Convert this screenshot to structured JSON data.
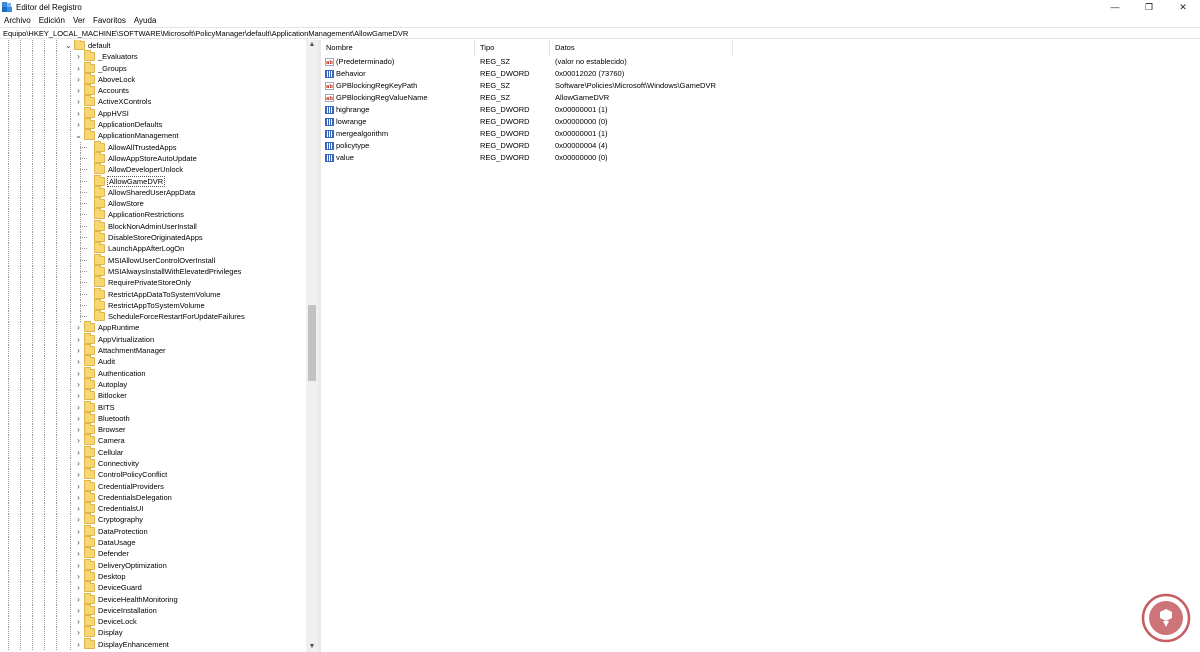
{
  "window": {
    "title": "Editor del Registro",
    "controls": {
      "minimize": "—",
      "maximize": "❐",
      "close": "✕"
    }
  },
  "menu": [
    "Archivo",
    "Edición",
    "Ver",
    "Favoritos",
    "Ayuda"
  ],
  "address": "Equipo\\HKEY_LOCAL_MACHINE\\SOFTWARE\\Microsoft\\PolicyManager\\default\\ApplicationManagement\\AllowGameDVR",
  "tree": [
    {
      "label": "default",
      "level": 0,
      "expander": "expanded"
    },
    {
      "label": "_Evaluators",
      "level": 1,
      "expander": "collapsed"
    },
    {
      "label": "_Groups",
      "level": 1,
      "expander": "collapsed"
    },
    {
      "label": "AboveLock",
      "level": 1,
      "expander": "collapsed"
    },
    {
      "label": "Accounts",
      "level": 1,
      "expander": "collapsed"
    },
    {
      "label": "ActiveXControls",
      "level": 1,
      "expander": "collapsed"
    },
    {
      "label": "AppHVSI",
      "level": 1,
      "expander": "collapsed"
    },
    {
      "label": "ApplicationDefaults",
      "level": 1,
      "expander": "collapsed"
    },
    {
      "label": "ApplicationManagement",
      "level": 1,
      "expander": "expanded"
    },
    {
      "label": "AllowAllTrustedApps",
      "level": 2,
      "expander": "none"
    },
    {
      "label": "AllowAppStoreAutoUpdate",
      "level": 2,
      "expander": "none"
    },
    {
      "label": "AllowDeveloperUnlock",
      "level": 2,
      "expander": "none"
    },
    {
      "label": "AllowGameDVR",
      "level": 2,
      "expander": "none",
      "selected": true
    },
    {
      "label": "AllowSharedUserAppData",
      "level": 2,
      "expander": "none"
    },
    {
      "label": "AllowStore",
      "level": 2,
      "expander": "none"
    },
    {
      "label": "ApplicationRestrictions",
      "level": 2,
      "expander": "none"
    },
    {
      "label": "BlockNonAdminUserInstall",
      "level": 2,
      "expander": "none"
    },
    {
      "label": "DisableStoreOriginatedApps",
      "level": 2,
      "expander": "none"
    },
    {
      "label": "LaunchAppAfterLogOn",
      "level": 2,
      "expander": "none"
    },
    {
      "label": "MSIAllowUserControlOverInstall",
      "level": 2,
      "expander": "none"
    },
    {
      "label": "MSIAlwaysInstallWithElevatedPrivileges",
      "level": 2,
      "expander": "none"
    },
    {
      "label": "RequirePrivateStoreOnly",
      "level": 2,
      "expander": "none"
    },
    {
      "label": "RestrictAppDataToSystemVolume",
      "level": 2,
      "expander": "none"
    },
    {
      "label": "RestrictAppToSystemVolume",
      "level": 2,
      "expander": "none"
    },
    {
      "label": "ScheduleForceRestartForUpdateFailures",
      "level": 2,
      "expander": "none"
    },
    {
      "label": "AppRuntime",
      "level": 1,
      "expander": "collapsed"
    },
    {
      "label": "AppVirtualization",
      "level": 1,
      "expander": "collapsed"
    },
    {
      "label": "AttachmentManager",
      "level": 1,
      "expander": "collapsed"
    },
    {
      "label": "Audit",
      "level": 1,
      "expander": "collapsed"
    },
    {
      "label": "Authentication",
      "level": 1,
      "expander": "collapsed"
    },
    {
      "label": "Autoplay",
      "level": 1,
      "expander": "collapsed"
    },
    {
      "label": "Bitlocker",
      "level": 1,
      "expander": "collapsed"
    },
    {
      "label": "BITS",
      "level": 1,
      "expander": "collapsed"
    },
    {
      "label": "Bluetooth",
      "level": 1,
      "expander": "collapsed"
    },
    {
      "label": "Browser",
      "level": 1,
      "expander": "collapsed"
    },
    {
      "label": "Camera",
      "level": 1,
      "expander": "collapsed"
    },
    {
      "label": "Cellular",
      "level": 1,
      "expander": "collapsed"
    },
    {
      "label": "Connectivity",
      "level": 1,
      "expander": "collapsed"
    },
    {
      "label": "ControlPolicyConflict",
      "level": 1,
      "expander": "collapsed"
    },
    {
      "label": "CredentialProviders",
      "level": 1,
      "expander": "collapsed"
    },
    {
      "label": "CredentialsDelegation",
      "level": 1,
      "expander": "collapsed"
    },
    {
      "label": "CredentialsUI",
      "level": 1,
      "expander": "collapsed"
    },
    {
      "label": "Cryptography",
      "level": 1,
      "expander": "collapsed"
    },
    {
      "label": "DataProtection",
      "level": 1,
      "expander": "collapsed"
    },
    {
      "label": "DataUsage",
      "level": 1,
      "expander": "collapsed"
    },
    {
      "label": "Defender",
      "level": 1,
      "expander": "collapsed"
    },
    {
      "label": "DeliveryOptimization",
      "level": 1,
      "expander": "collapsed"
    },
    {
      "label": "Desktop",
      "level": 1,
      "expander": "collapsed"
    },
    {
      "label": "DeviceGuard",
      "level": 1,
      "expander": "collapsed"
    },
    {
      "label": "DeviceHealthMonitoring",
      "level": 1,
      "expander": "collapsed"
    },
    {
      "label": "DeviceInstallation",
      "level": 1,
      "expander": "collapsed"
    },
    {
      "label": "DeviceLock",
      "level": 1,
      "expander": "collapsed"
    },
    {
      "label": "Display",
      "level": 1,
      "expander": "collapsed"
    },
    {
      "label": "DisplayEnhancement",
      "level": 1,
      "expander": "collapsed"
    }
  ],
  "values_table": {
    "headers": {
      "name": "Nombre",
      "type": "Tipo",
      "data": "Datos"
    },
    "rows": [
      {
        "icon": "string-value-icon",
        "name": "(Predeterminado)",
        "type": "REG_SZ",
        "data": "(valor no establecido)"
      },
      {
        "icon": "dword-value-icon",
        "name": "Behavior",
        "type": "REG_DWORD",
        "data": "0x00012020 (73760)"
      },
      {
        "icon": "string-value-icon",
        "name": "GPBlockingRegKeyPath",
        "type": "REG_SZ",
        "data": "Software\\Policies\\Microsoft\\Windows\\GameDVR"
      },
      {
        "icon": "string-value-icon",
        "name": "GPBlockingRegValueName",
        "type": "REG_SZ",
        "data": "AllowGameDVR"
      },
      {
        "icon": "dword-value-icon",
        "name": "highrange",
        "type": "REG_DWORD",
        "data": "0x00000001 (1)"
      },
      {
        "icon": "dword-value-icon",
        "name": "lowrange",
        "type": "REG_DWORD",
        "data": "0x00000000 (0)"
      },
      {
        "icon": "dword-value-icon",
        "name": "mergealgorithm",
        "type": "REG_DWORD",
        "data": "0x00000001 (1)"
      },
      {
        "icon": "dword-value-icon",
        "name": "policytype",
        "type": "REG_DWORD",
        "data": "0x00000004 (4)"
      },
      {
        "icon": "dword-value-icon",
        "name": "value",
        "type": "REG_DWORD",
        "data": "0x00000000 (0)"
      }
    ]
  },
  "icons": {
    "string_glyph": "ab",
    "scroll_up": "▲",
    "scroll_down": "▼",
    "chevron_collapsed": "›",
    "chevron_expanded": "⌄"
  },
  "colors": {
    "folder": "#f7d774",
    "watermark": "#c45c61"
  }
}
